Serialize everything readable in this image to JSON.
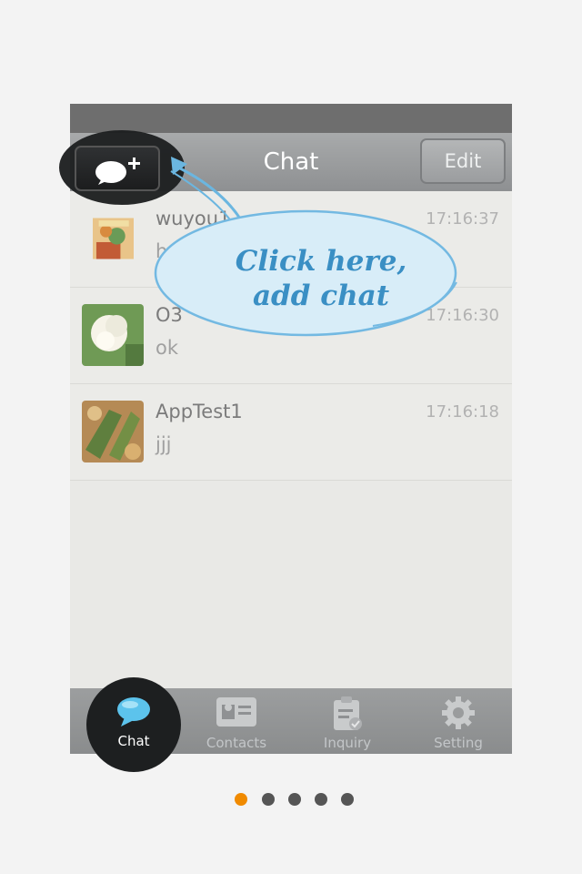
{
  "navbar": {
    "title": "Chat",
    "edit_label": "Edit"
  },
  "chats": [
    {
      "name": "wuyou1",
      "message": "hello",
      "time": "17:16:37",
      "avatar_icon": "flower-photo-icon"
    },
    {
      "name": "O3",
      "message": "ok",
      "time": "17:16:30",
      "avatar_icon": "white-rose-photo-icon"
    },
    {
      "name": "AppTest1",
      "message": "jjj",
      "time": "17:16:18",
      "avatar_icon": "food-photo-icon"
    }
  ],
  "tabs": [
    {
      "label": "Chat",
      "icon": "chat-bubble-icon"
    },
    {
      "label": "Contacts",
      "icon": "contact-card-icon"
    },
    {
      "label": "Inquiry",
      "icon": "clipboard-check-icon"
    },
    {
      "label": "Setting",
      "icon": "gear-icon"
    }
  ],
  "tooltip": {
    "line1": "Click here,",
    "line2": "add chat"
  },
  "pager": {
    "active_index": 0,
    "count": 5,
    "active_color": "#f08a00",
    "inactive_color": "#555555"
  },
  "colors": {
    "tooltip_text": "#3a8fc4",
    "tooltip_fill": "#d8edf8"
  }
}
